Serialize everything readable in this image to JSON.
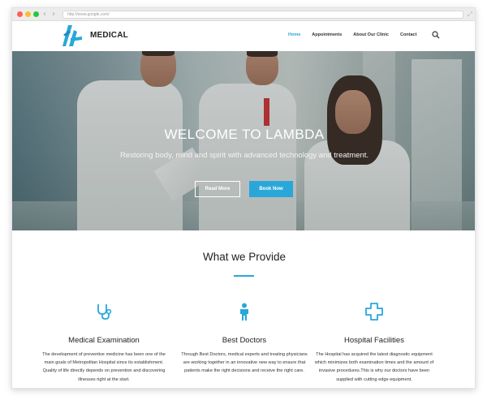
{
  "browser": {
    "url": "http://www.google.com/"
  },
  "header": {
    "brand": "MEDICAL",
    "nav": [
      {
        "label": "Home",
        "active": true
      },
      {
        "label": "Appointments",
        "active": false
      },
      {
        "label": "About Our Clinic",
        "active": false
      },
      {
        "label": "Contact",
        "active": false
      }
    ]
  },
  "hero": {
    "title": "WELCOME TO LAMBDA",
    "subtitle": "Restoring body, mind and spirit with advanced technology and treatment.",
    "read_more": "Read More",
    "book_now": "Book Now"
  },
  "provide": {
    "title": "What we Provide",
    "features": [
      {
        "icon": "stethoscope-icon",
        "title": "Medical Examination",
        "text": "The development of preventive medicine has been one of the main goals of Metropolitan Hospital since its establishment. Quality of life directly depends on prevention and discovering illnesses right at the start."
      },
      {
        "icon": "doctor-person-icon",
        "title": "Best Doctors",
        "text": "Through Best Doctors, medical experts and treating physicians are working together in an innovative new way to ensure that patients make the right decisions and receive the right care."
      },
      {
        "icon": "medical-cross-icon",
        "title": "Hospital Facilities",
        "text": "The Hospital has acquired the latest diagnostic equipment which minimizes both examination times and the amount of invasive procedures.This is why our doctors have been supplied with cutting edge equipment."
      }
    ]
  },
  "colors": {
    "accent": "#29a7d9",
    "heading": "#222222",
    "body_text": "#333333"
  }
}
